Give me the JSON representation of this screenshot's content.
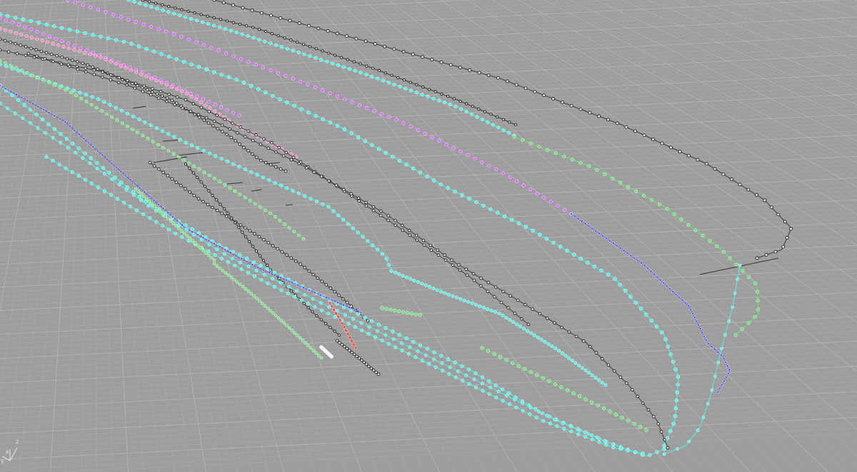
{
  "viewport": {
    "background_color": "#9d9d9d",
    "grid_minor_color": "#a9a9a9",
    "grid_major_color": "#b4b4b4",
    "projection": "perspective"
  },
  "axes_widget": {
    "x_label": "x",
    "y_label": "y",
    "z_label": "z",
    "axis_color": "#e0e0e0"
  },
  "point_colors": {
    "black": "#2a2a2a",
    "cyan": "#55f0e6",
    "blue": "#5a5ad8",
    "green": "#6fe07a",
    "magenta": "#d36ef0",
    "pink": "#f08ac0",
    "red": "#e84040",
    "white": "#f4f4f4"
  }
}
